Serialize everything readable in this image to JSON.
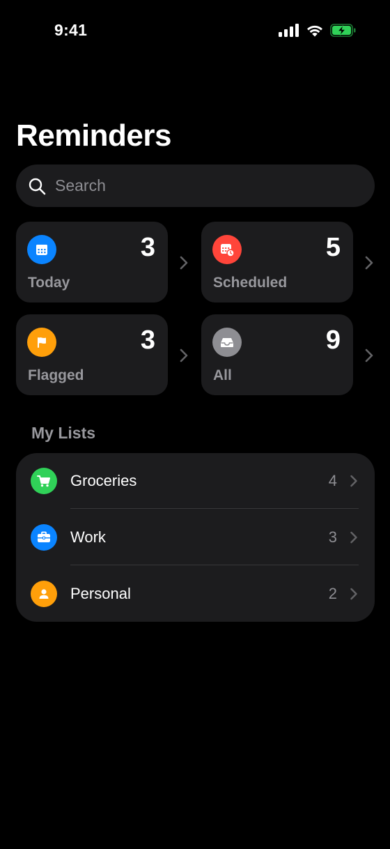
{
  "status_bar": {
    "time": "9:41",
    "icons": [
      "cellular-signal-icon",
      "wifi-icon",
      "battery-charging-icon"
    ]
  },
  "title": "Reminders",
  "search": {
    "placeholder": "Search",
    "value": ""
  },
  "smart_lists": [
    {
      "label": "Today",
      "count": "3",
      "icon": "calendar-icon",
      "color": "#0a84ff"
    },
    {
      "label": "Scheduled",
      "count": "5",
      "icon": "calendar-clock-icon",
      "color": "#ff453a"
    },
    {
      "label": "Flagged",
      "count": "3",
      "icon": "flag-icon",
      "color": "#ff9f0a"
    },
    {
      "label": "All",
      "count": "9",
      "icon": "tray-icon",
      "color": "#8e8e93"
    }
  ],
  "my_lists": {
    "header": "My Lists",
    "items": [
      {
        "name": "Groceries",
        "count": "4",
        "icon": "cart-icon",
        "color": "#30d158"
      },
      {
        "name": "Work",
        "count": "3",
        "icon": "briefcase-icon",
        "color": "#0a84ff"
      },
      {
        "name": "Personal",
        "count": "2",
        "icon": "person-icon",
        "color": "#ff9f0a"
      }
    ]
  },
  "colors": {
    "background": "#000000",
    "surface": "#1c1c1e",
    "secondary_text": "#98989d",
    "battery_green": "#30d158"
  }
}
